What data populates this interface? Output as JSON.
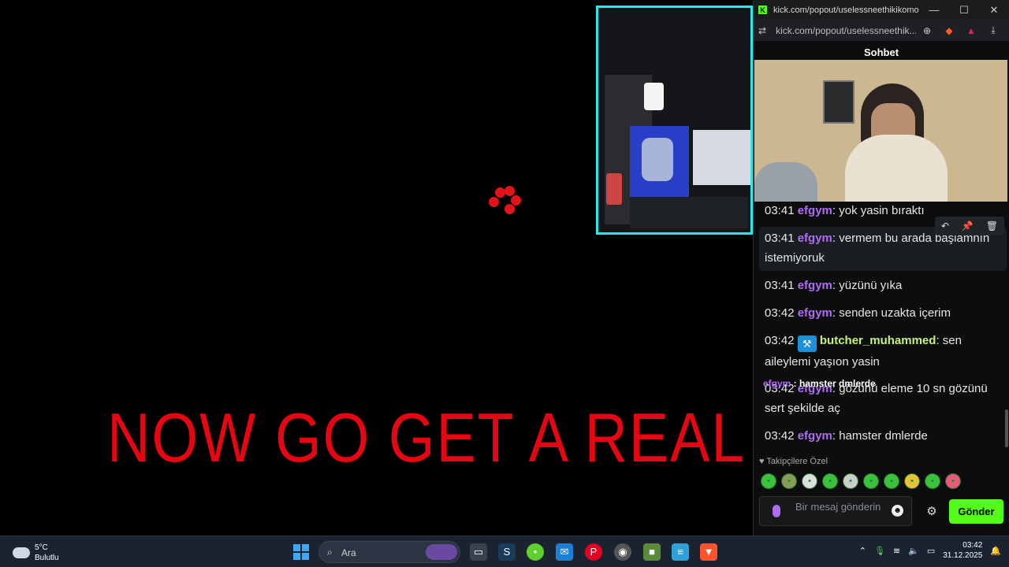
{
  "stage": {
    "big_text": "NOW GO GET A REAL"
  },
  "browser": {
    "title": "kick.com/popout/uselessneethikikomori...",
    "url": "kick.com/popout/uselessneethik...",
    "controls": {
      "minimize": "—",
      "maximize": "☐",
      "close": "✕"
    }
  },
  "chat": {
    "header": "Sohbet",
    "messages": [
      {
        "time": "03:41",
        "user": "efgym",
        "sep": ":",
        "text": " yok yasin bıraktı"
      },
      {
        "time": "03:41",
        "user": "efgym",
        "sep": ":",
        "text": " vermem bu arada başlamnın istemiyoruk"
      },
      {
        "time": "03:41",
        "user": "efgym",
        "sep": ":",
        "text": " yüzünü yıka"
      },
      {
        "time": "03:42",
        "user": "efgym",
        "sep": ":",
        "text": " senden uzakta içerim"
      },
      {
        "time": "03:42",
        "user": "butcher_muhammed",
        "sep": ":",
        "text": " sen aileylemi yaşıon yasin"
      },
      {
        "time": "03:42",
        "user": "efgym",
        "sep": ":",
        "text": " gözünü eleme 10 sn gözünü sert şekilde aç"
      },
      {
        "time": "03:42",
        "user": "efgym",
        "sep": ":",
        "text": " hamster dmlerde"
      }
    ],
    "toast": {
      "user": "efgym",
      "text": " : hamster dmlerde"
    },
    "followers_label": "Takipçilere Özel",
    "input_placeholder": "Bir mesaj gönderin",
    "send_label": "Gönder"
  },
  "taskbar": {
    "weather_temp": "5°C",
    "weather_desc": "Bulutlu",
    "search_label": "Ara",
    "time": "03:42",
    "date": "31.12.2025"
  },
  "colors": {
    "accent": "#53fc18",
    "username": "#b06cf5",
    "stage_text": "#e30613",
    "webcam_border": "#2ee6e6"
  }
}
